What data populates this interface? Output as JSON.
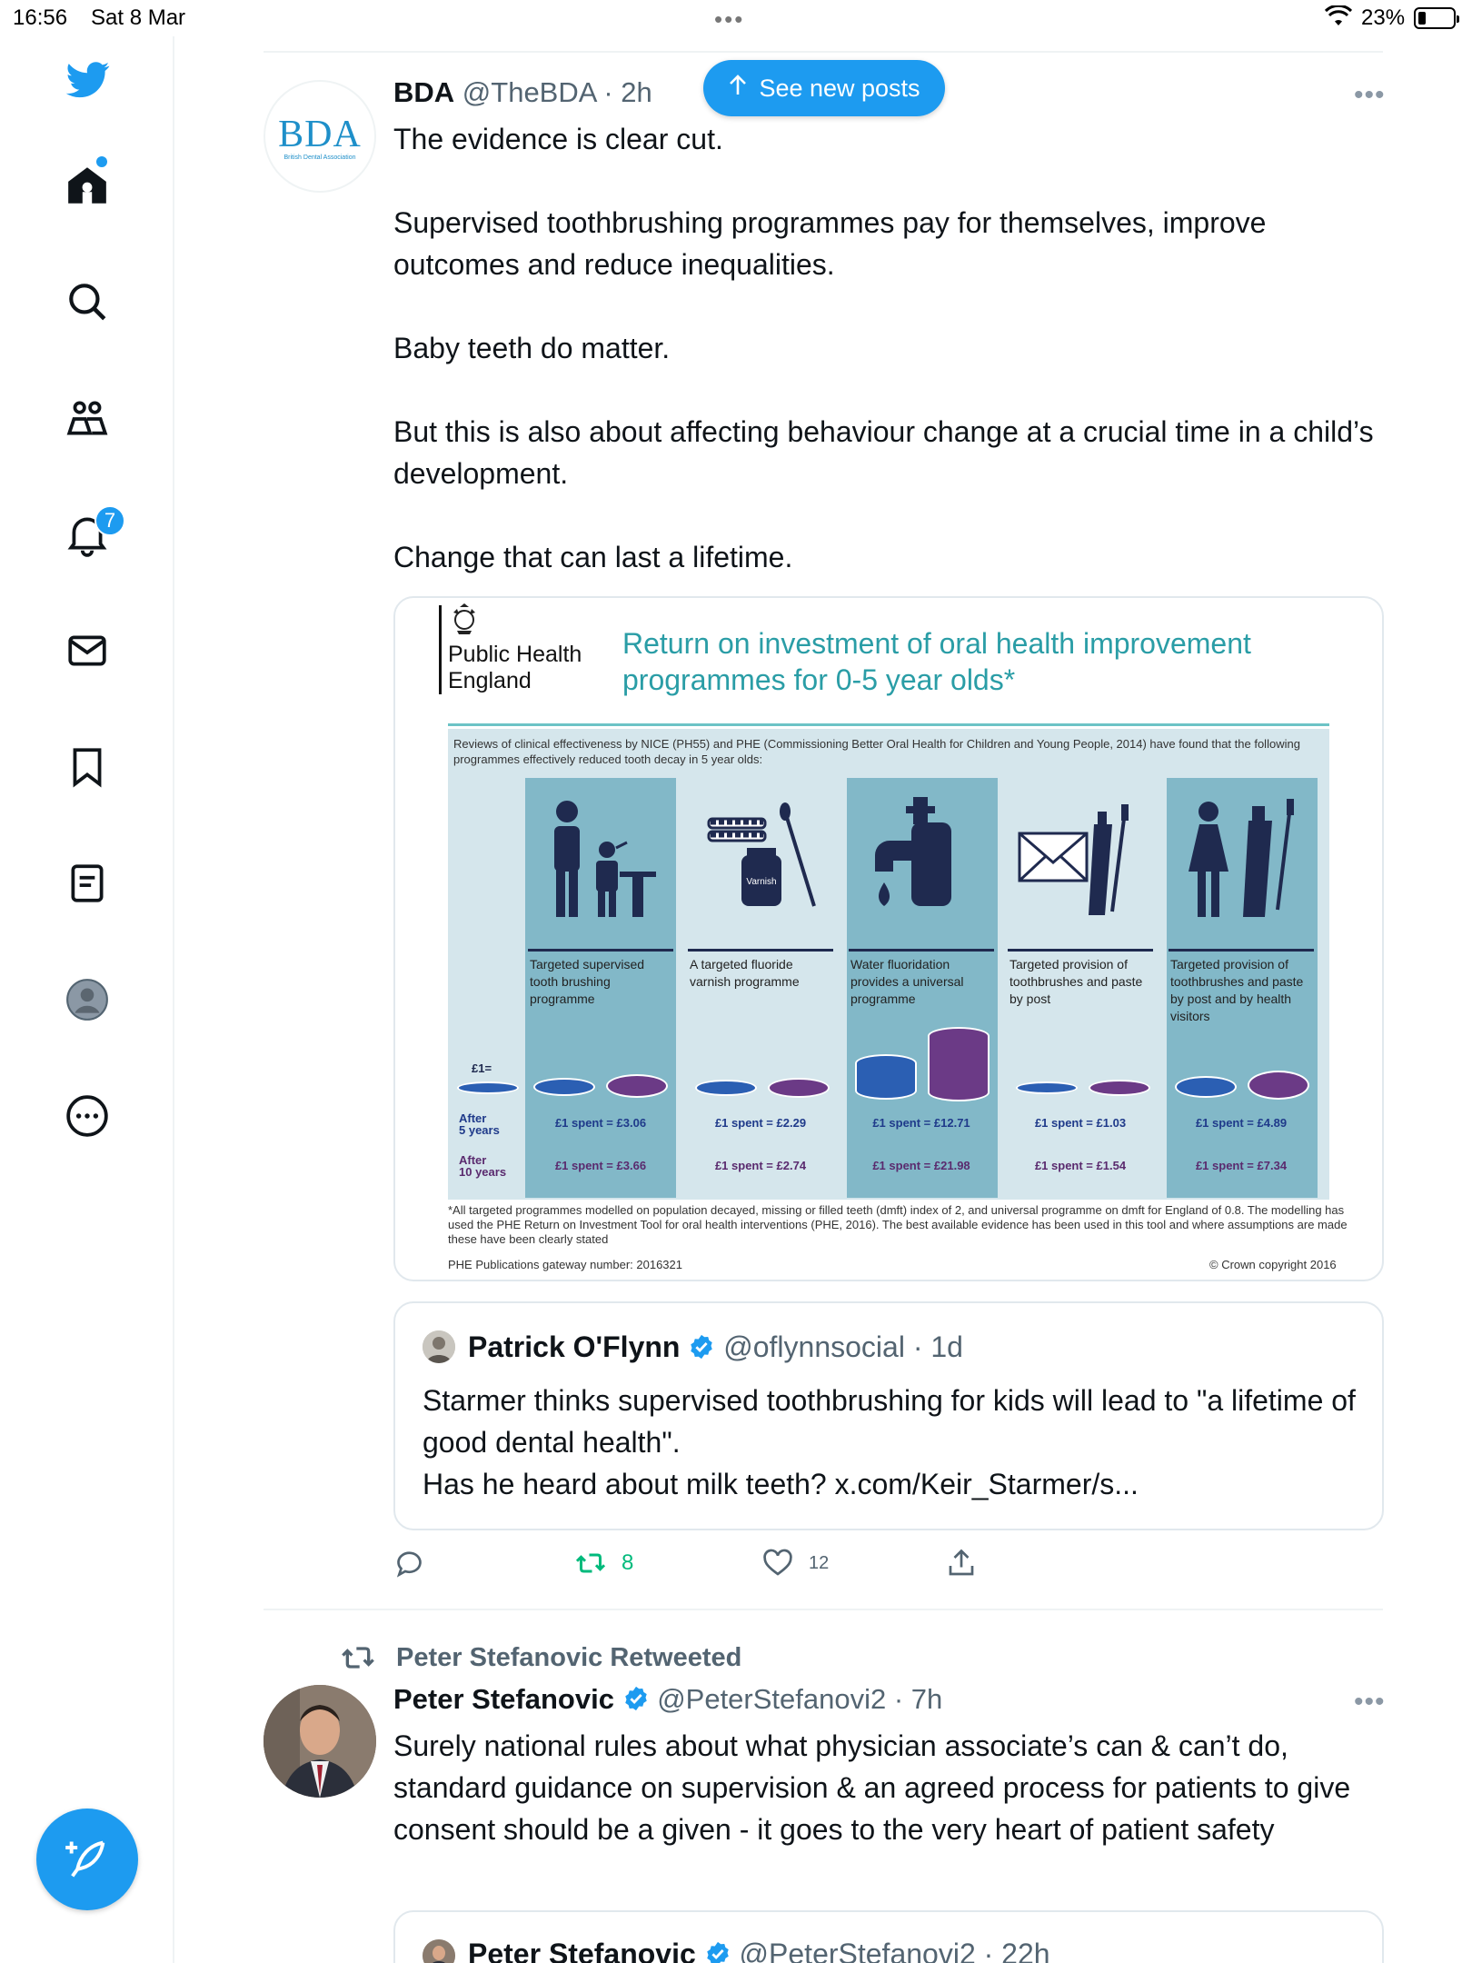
{
  "status_bar": {
    "time": "16:56",
    "date": "Sat 8 Mar",
    "dots": "•••",
    "battery_pct": "23%"
  },
  "nav": {
    "items": [
      "home",
      "search",
      "communities",
      "notifications",
      "messages",
      "bookmarks",
      "lists",
      "profile",
      "more"
    ],
    "notifications_badge": "7",
    "accent": "#1d9bf0"
  },
  "new_posts_label": "See new posts",
  "tweet1": {
    "avatar_text": "BDA",
    "avatar_sub": "British Dental Association",
    "name": "BDA",
    "handle": "@TheBDA",
    "time": "· 2h",
    "text": "The evidence is clear cut.\n\nSupervised toothbrushing programmes pay for themselves, improve outcomes and reduce inequalities.\n\nBaby teeth do matter.\n\nBut this is also about affecting behaviour change at a crucial time in a child’s development.\n\nChange that can last a lifetime.",
    "more": "•••"
  },
  "infographic": {
    "org_line1": "Public Health",
    "org_line2": "England",
    "title_line1": "Return on investment of oral health improvement",
    "title_line2": "programmes for 0-5 year olds*",
    "intro": "Reviews of clinical effectiveness by NICE (PH55) and PHE (Commissioning Better Oral Health for Children and Young People, 2014) have found that the following programmes effectively reduced tooth decay in 5 year olds:",
    "varnish_label": "Varnish",
    "eq_label": "£1=",
    "row1_label_a": "After",
    "row1_label_b": "5 years",
    "row2_label_a": "After",
    "row2_label_b": "10 years",
    "programmes": [
      {
        "label": "Targeted supervised tooth brushing programme",
        "five": "£1 spent = £3.06",
        "ten": "£1 spent = £3.66"
      },
      {
        "label": "A targeted fluoride varnish programme",
        "five": "£1 spent = £2.29",
        "ten": "£1 spent = £2.74"
      },
      {
        "label": "Water fluoridation provides a universal programme",
        "five": "£1 spent = £12.71",
        "ten": "£1 spent = £21.98"
      },
      {
        "label": "Targeted provision of toothbrushes and paste by post",
        "five": "£1 spent = £1.03",
        "ten": "£1 spent = £1.54"
      },
      {
        "label": "Targeted provision of toothbrushes and paste by post and by health visitors",
        "five": "£1 spent = £4.89",
        "ten": "£1 spent = £7.34"
      }
    ],
    "footnote": "*All targeted programmes modelled on population decayed, missing or filled teeth (dmft) index of 2, and universal programme on dmft for England of 0.8. The modelling has used the PHE Return on Investment Tool for oral health interventions (PHE, 2016). The best available evidence has been used in this tool and where assumptions are made these have been clearly stated",
    "gateway": "PHE Publications gateway number: 2016321",
    "copyright": "© Crown copyright 2016",
    "colors": {
      "teal_title": "#2a9da6",
      "column": "#82b8c8",
      "panel": "#d5e6ec",
      "navy": "#1f2a4f",
      "blue_coin": "#2b5fb3",
      "purple_coin": "#6b3a86"
    }
  },
  "quote": {
    "name": "Patrick O'Flynn",
    "handle": "@oflynnsocial",
    "time": "· 1d",
    "text": "Starmer thinks supervised toothbrushing for kids will lead to \"a lifetime of good dental health\".\nHas he heard about milk teeth? x.com/Keir_Starmer/s..."
  },
  "actions": {
    "retweets": "8",
    "likes": "12"
  },
  "tweet2": {
    "retweeted_by": "Peter Stefanovic Retweeted",
    "name": "Peter Stefanovic",
    "handle": "@PeterStefanovi2",
    "time": "· 7h",
    "text": "Surely national rules about what physician associate’s can & can’t do, standard guidance on supervision & an agreed process for patients to give consent should be a given - it goes to the very heart of patient safety",
    "more": "•••",
    "quote_name": "Peter Stefanovic",
    "quote_handle": "@PeterStefanovi2",
    "quote_time": "· 22h"
  }
}
